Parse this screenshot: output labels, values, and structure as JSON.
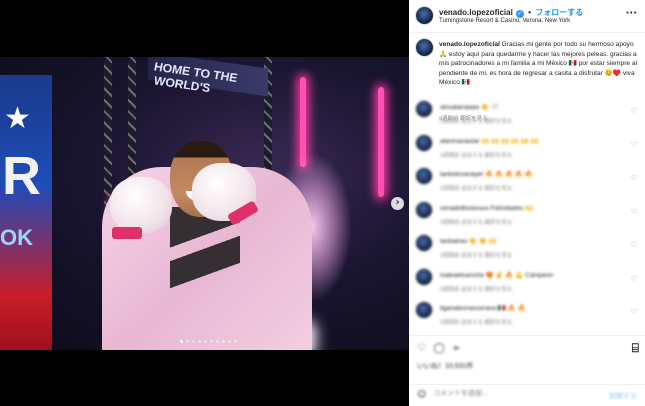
{
  "header": {
    "username": "venado.lopezoficial",
    "verified_glyph": "✓",
    "separator": "•",
    "follow_label": "フォローする",
    "location": "Turningstone Resort & Casino, Verona, New York",
    "more_glyph": "···"
  },
  "media": {
    "banner_text": "HOME TO THE WORLD'S",
    "banner_letter": "R",
    "banner_side": "OK",
    "next_glyph": "›",
    "dots_count": 10,
    "active_dot": 0
  },
  "caption": {
    "username": "venado.lopezoficial",
    "text": "Gracias mi gente por todo su hermoso apoyo 🙏 estoy aquí para quedarme y hacer las mejores peleas. gracias a mis patrocinadores a mi familia a mi México 🇲🇽 por estar siempre al pendiente de mi. es hora de regresar a casita a disfrutar 😊♥️ viva México 🇲🇽",
    "meta": "9週間前   翻訳を見る"
  },
  "comments": [
    {
      "text": "ainsatanaaaa 👏 🤍",
      "meta": "9週間前  返信する  翻訳を見る"
    },
    {
      "text": "alanmanastar 🙌 🙌 🙌 🙌 🙌 🙌",
      "meta": "9週間前  返信する  翻訳を見る"
    },
    {
      "text": "lankidxsanayer 🔥 🔥 🔥 🔥 🔥",
      "meta": "9週間前  返信する  翻訳を見る"
    },
    {
      "text": "venadolbxiasouo Felicidades 🙌",
      "meta": "9週間前  返信する  翻訳を見る"
    },
    {
      "text": "tanbalrao 👏 👏 🙌",
      "meta": "9週間前  返信する  翻訳を見る"
    },
    {
      "text": "isaleaelsanorta 😍 ✌️ 🔥 💪 Campeon",
      "meta": "9週間前  返信する  翻訳を見る"
    },
    {
      "text": "liganalesnascerana 🇲🇽 🔥 🔥",
      "meta": "9週間前  返信する  翻訳を見る"
    }
  ],
  "actions": {
    "icons": "♡ ◯ ➢",
    "bookmark_glyph": "⌸"
  },
  "likes": "いいね！10,531件",
  "add_comment": {
    "emoji_glyph": "☺",
    "placeholder": "コメントを追加...",
    "post_label": "投稿する"
  }
}
